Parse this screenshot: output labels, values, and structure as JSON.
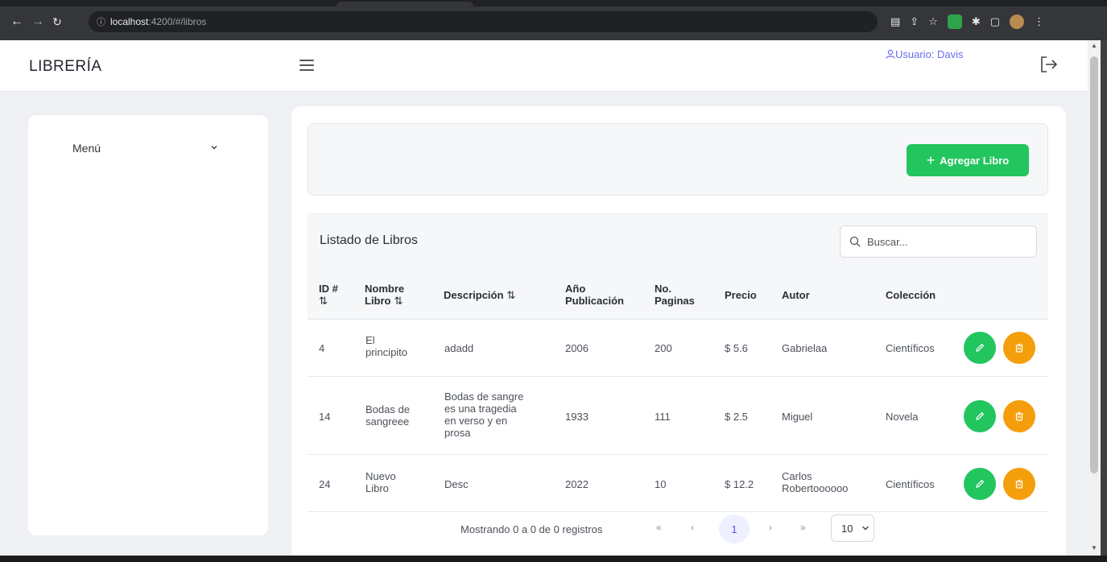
{
  "browser": {
    "url_host": "localhost",
    "url_rest": ":4200/#/libros"
  },
  "header": {
    "brand": "LIBRERÍA",
    "user": "Usuario: Davis"
  },
  "sidebar": {
    "menu_label": "Menú"
  },
  "toolbar": {
    "add_label": "Agregar Libro"
  },
  "table": {
    "title": "Listado de Libros",
    "search_placeholder": "Buscar...",
    "columns": {
      "id": "ID #",
      "nombre_1": "Nombre",
      "nombre_2": "Libro",
      "descripcion": "Descripción",
      "anio_1": "Año",
      "anio_2": "Publicación",
      "paginas_1": "No.",
      "paginas_2": "Paginas",
      "precio": "Precio",
      "autor": "Autor",
      "coleccion": "Colección"
    },
    "sort_icon": "⇅",
    "rows": [
      {
        "id": "4",
        "nombre_1": "El",
        "nombre_2": "principito",
        "desc": [
          "adadd"
        ],
        "anio": "2006",
        "paginas": "200",
        "precio": "$ 5.6",
        "autor_1": "Gabrielaa",
        "autor_2": "",
        "coleccion": "Científicos"
      },
      {
        "id": "14",
        "nombre_1": "Bodas de",
        "nombre_2": "sangreee",
        "desc": [
          "Bodas de sangre",
          "es una tragedia",
          "en verso y en",
          "prosa"
        ],
        "anio": "1933",
        "paginas": "111",
        "precio": "$ 2.5",
        "autor_1": "Miguel",
        "autor_2": "",
        "coleccion": "Novela"
      },
      {
        "id": "24",
        "nombre_1": "Nuevo",
        "nombre_2": "Libro",
        "desc": [
          "Desc"
        ],
        "anio": "2022",
        "paginas": "10",
        "precio": "$ 12.2",
        "autor_1": "Carlos",
        "autor_2": "Robertoooooo",
        "coleccion": "Científicos"
      }
    ]
  },
  "pagination": {
    "info": "Mostrando 0 a 0 de 0 registros",
    "first": "«",
    "prev": "‹",
    "current": "1",
    "next": "›",
    "last": "»",
    "page_size": "10"
  },
  "colors": {
    "accent_green": "#22c55e",
    "accent_orange": "#f59e0b",
    "user_link": "#6a6cf0"
  }
}
